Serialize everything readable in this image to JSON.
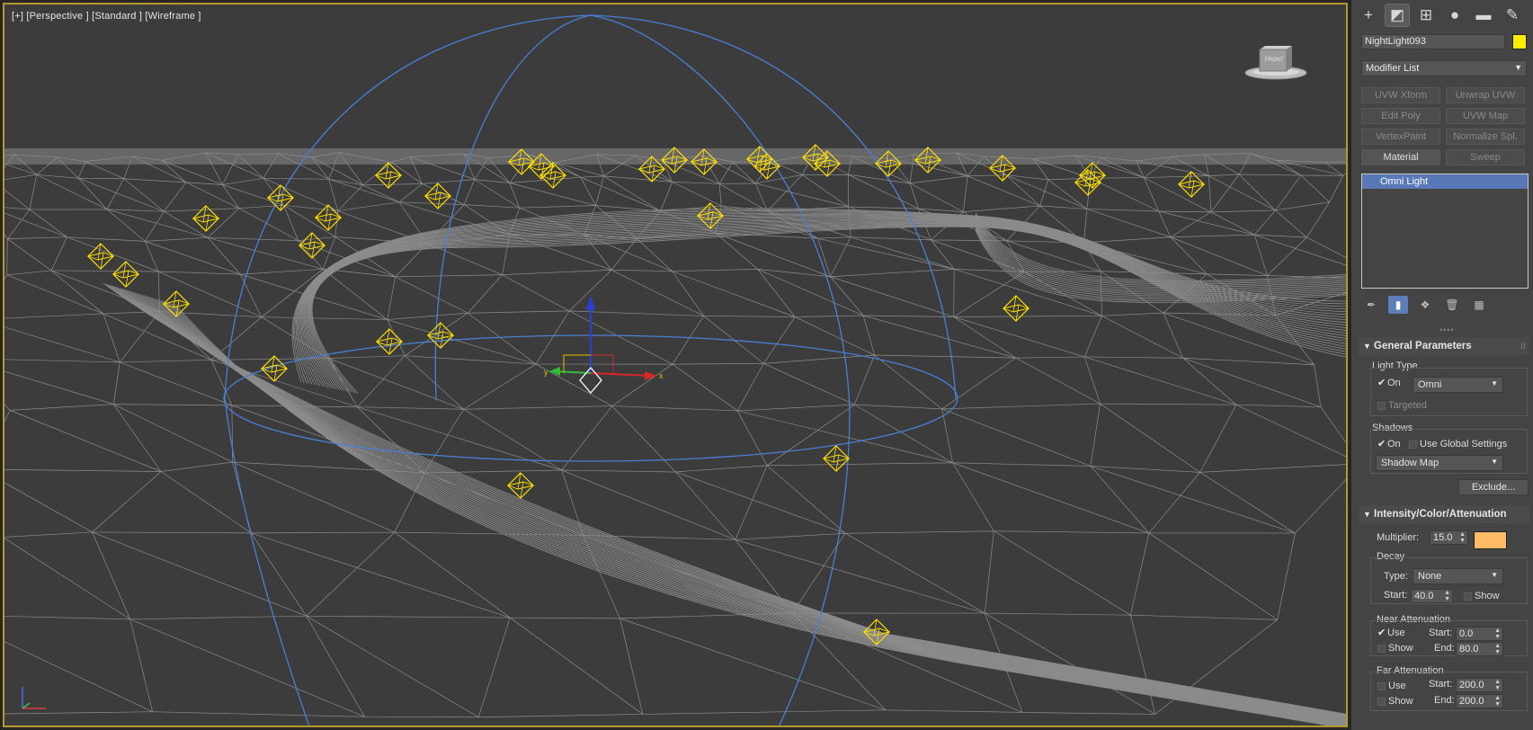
{
  "viewport": {
    "label": "[+] [Perspective ] [Standard ] [Wireframe ]",
    "border_color": "#b49a2a",
    "background": "#3c3c3c",
    "wire_color": "#9a9a9a",
    "light_helper_color": "#ffe000",
    "attenuation_color": "#4a7fd6",
    "viewcube_label": "FRONT",
    "axis_labels": [
      "x",
      "y",
      "z"
    ]
  },
  "command_panel": {
    "tabs": [
      {
        "icon": "create-icon",
        "glyph": "+"
      },
      {
        "icon": "modify-icon",
        "glyph": "◩"
      },
      {
        "icon": "hierarchy-icon",
        "glyph": "⊞"
      },
      {
        "icon": "motion-icon",
        "glyph": "●"
      },
      {
        "icon": "display-icon",
        "glyph": "▬"
      },
      {
        "icon": "utilities-icon",
        "glyph": "✎"
      }
    ],
    "object_name": "NightLight093",
    "object_color": "#ffee00",
    "modifier_list": "Modifier List",
    "modifier_buttons": [
      {
        "label": "UVW Xform",
        "enabled": false
      },
      {
        "label": "Unwrap UVW",
        "enabled": false
      },
      {
        "label": "Edit Poly",
        "enabled": false
      },
      {
        "label": "UVW Map",
        "enabled": false
      },
      {
        "label": "VertexPaint",
        "enabled": false
      },
      {
        "label": "Normalize Spl.",
        "enabled": false
      },
      {
        "label": "Material",
        "enabled": true
      },
      {
        "label": "Sweep",
        "enabled": false
      }
    ],
    "stack_items": [
      "Omni Light"
    ]
  },
  "general_parameters": {
    "title": "General Parameters",
    "light_type_group": "Light Type",
    "on_label": "On",
    "on_checked": true,
    "type_value": "Omni",
    "targeted_label": "Targeted",
    "shadows_group": "Shadows",
    "shadows_on_label": "On",
    "shadows_on_checked": true,
    "use_global_label": "Use Global Settings",
    "use_global_checked": false,
    "shadow_type": "Shadow Map",
    "exclude_label": "Exclude..."
  },
  "intensity": {
    "title": "Intensity/Color/Attenuation",
    "multiplier_label": "Multiplier:",
    "multiplier_value": "15.0",
    "color": "#ffbb66",
    "decay_group": "Decay",
    "type_label": "Type:",
    "type_value": "None",
    "start_label": "Start:",
    "start_value": "40.0",
    "show_label": "Show",
    "near_group": "Near Attenuation",
    "near_use_label": "Use",
    "near_use_checked": true,
    "near_show_label": "Show",
    "near_start_label": "Start:",
    "near_start_value": "0.0",
    "near_end_label": "End:",
    "near_end_value": "80.0",
    "far_group": "Far Attenuation",
    "far_use_label": "Use",
    "far_show_label": "Show",
    "far_start_label": "Start:",
    "far_start_value": "200.0",
    "far_end_label": "End:",
    "far_end_value": "200.0"
  }
}
